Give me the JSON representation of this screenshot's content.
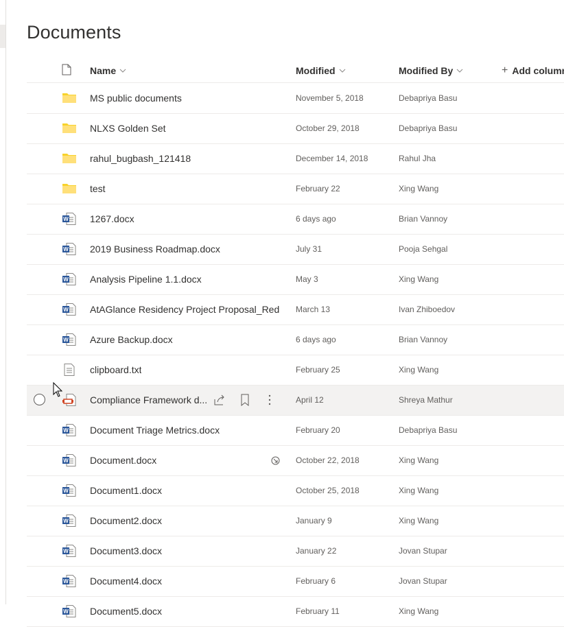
{
  "page": {
    "title": "Documents"
  },
  "columns": {
    "name": "Name",
    "modified": "Modified",
    "modified_by": "Modified By",
    "add_column": "Add column"
  },
  "rows": [
    {
      "type": "folder",
      "name": "MS public documents",
      "modified": "November 5, 2018",
      "modified_by": "Debapriya Basu"
    },
    {
      "type": "folder",
      "name": "NLXS Golden Set",
      "modified": "October 29, 2018",
      "modified_by": "Debapriya Basu"
    },
    {
      "type": "folder",
      "name": "rahul_bugbash_121418",
      "modified": "December 14, 2018",
      "modified_by": "Rahul Jha"
    },
    {
      "type": "folder",
      "name": "test",
      "modified": "February 22",
      "modified_by": "Xing Wang"
    },
    {
      "type": "docx",
      "name": "1267.docx",
      "modified": "6 days ago",
      "modified_by": "Brian Vannoy"
    },
    {
      "type": "docx",
      "name": "2019 Business Roadmap.docx",
      "modified": "July 31",
      "modified_by": "Pooja Sehgal"
    },
    {
      "type": "docx",
      "name": "Analysis Pipeline 1.1.docx",
      "modified": "May 3",
      "modified_by": "Xing Wang"
    },
    {
      "type": "docx",
      "name": "AtAGlance Residency Project Proposal_Red...",
      "modified": "March 13",
      "modified_by": "Ivan Zhiboedov"
    },
    {
      "type": "docx",
      "name": "Azure Backup.docx",
      "modified": "6 days ago",
      "modified_by": "Brian Vannoy"
    },
    {
      "type": "txt",
      "name": "clipboard.txt",
      "modified": "February 25",
      "modified_by": "Xing Wang"
    },
    {
      "type": "pptx",
      "name": "Compliance Framework d...",
      "modified": "April 12",
      "modified_by": "Shreya Mathur"
    },
    {
      "type": "docx",
      "name": "Document Triage Metrics.docx",
      "modified": "February 20",
      "modified_by": "Debapriya Basu"
    },
    {
      "type": "docx",
      "name": "Document.docx",
      "modified": "October 22, 2018",
      "modified_by": "Xing Wang"
    },
    {
      "type": "docx",
      "name": "Document1.docx",
      "modified": "October 25, 2018",
      "modified_by": "Xing Wang"
    },
    {
      "type": "docx",
      "name": "Document2.docx",
      "modified": "January 9",
      "modified_by": "Xing Wang"
    },
    {
      "type": "docx",
      "name": "Document3.docx",
      "modified": "January 22",
      "modified_by": "Jovan Stupar"
    },
    {
      "type": "docx",
      "name": "Document4.docx",
      "modified": "February 6",
      "modified_by": "Jovan Stupar"
    },
    {
      "type": "docx",
      "name": "Document5.docx",
      "modified": "February 11",
      "modified_by": "Xing Wang"
    }
  ],
  "colors": {
    "folder": "#f8d22a",
    "word": "#2b579a",
    "ppt": "#d04423",
    "text": "#323130",
    "meta": "#605e5c"
  }
}
